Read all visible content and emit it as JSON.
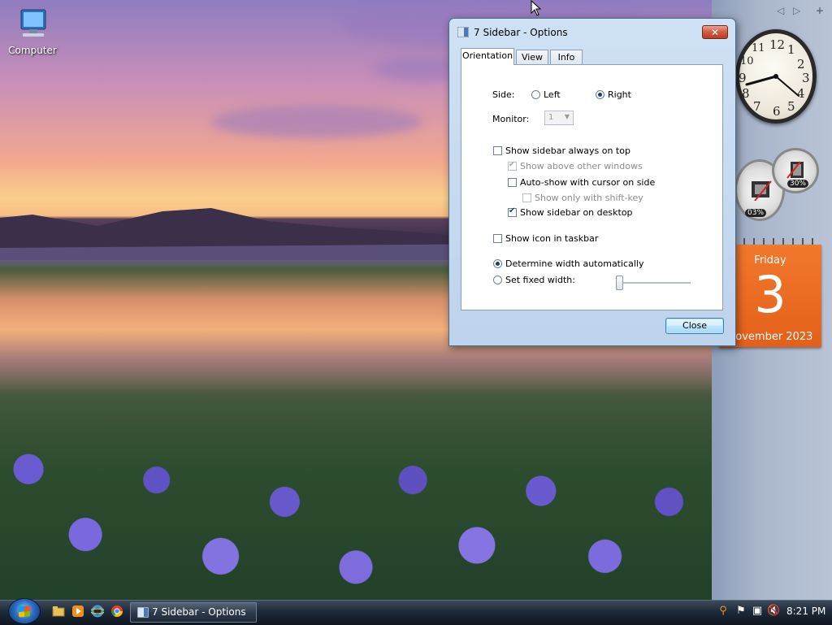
{
  "desktop": {
    "icons": [
      {
        "label": "Computer",
        "icon": "computer-icon"
      }
    ]
  },
  "dialog": {
    "title": "7 Sidebar - Options",
    "tabs": [
      {
        "label": "Orientation",
        "active": true
      },
      {
        "label": "View",
        "active": false
      },
      {
        "label": "Info",
        "active": false
      }
    ],
    "side": {
      "label": "Side:",
      "options": [
        {
          "label": "Left",
          "checked": false
        },
        {
          "label": "Right",
          "checked": true
        }
      ]
    },
    "monitor": {
      "label": "Monitor:",
      "value": "1",
      "disabled": true
    },
    "checkboxes": {
      "always_on_top": {
        "label": "Show sidebar always on top",
        "checked": false
      },
      "above_other_windows": {
        "label": "Show above other windows",
        "checked": true,
        "disabled": true
      },
      "auto_show": {
        "label": "Auto-show with cursor on side",
        "checked": false
      },
      "shift_key": {
        "label": "Show only with shift-key",
        "checked": false,
        "disabled": true
      },
      "on_desktop": {
        "label": "Show sidebar on desktop",
        "checked": true
      },
      "taskbar_icon": {
        "label": "Show icon in taskbar",
        "checked": false
      }
    },
    "width": {
      "auto": {
        "label": "Determine width automatically",
        "checked": true
      },
      "fixed": {
        "label": "Set fixed width:",
        "checked": false
      },
      "slider_value": 0
    },
    "close_button": "Close",
    "close_glyph": "✕"
  },
  "sidebar": {
    "controls": [
      "◁",
      "▷",
      "+"
    ],
    "clock_numbers": [
      "12",
      "1",
      "2",
      "3",
      "4",
      "5",
      "6",
      "7",
      "8",
      "9",
      "10",
      "11"
    ],
    "clock_time": "8:21",
    "meters": {
      "cpu": "03%",
      "memory": "30%"
    },
    "calendar": {
      "weekday": "Friday",
      "day": "3",
      "month_year": "November 2023"
    }
  },
  "taskbar": {
    "quick_launch": [
      "explorer-icon",
      "media-player-icon",
      "internet-explorer-icon",
      "chrome-icon"
    ],
    "window_button": "7 Sidebar - Options",
    "tray": [
      "search-icon",
      "action-center-icon",
      "network-icon",
      "volume-muted-icon"
    ],
    "time": "8:21 PM"
  },
  "colors": {
    "calendar": "#e4601a",
    "taskbar": "#1e2a38",
    "dialog_border": "#4c6a8c"
  }
}
